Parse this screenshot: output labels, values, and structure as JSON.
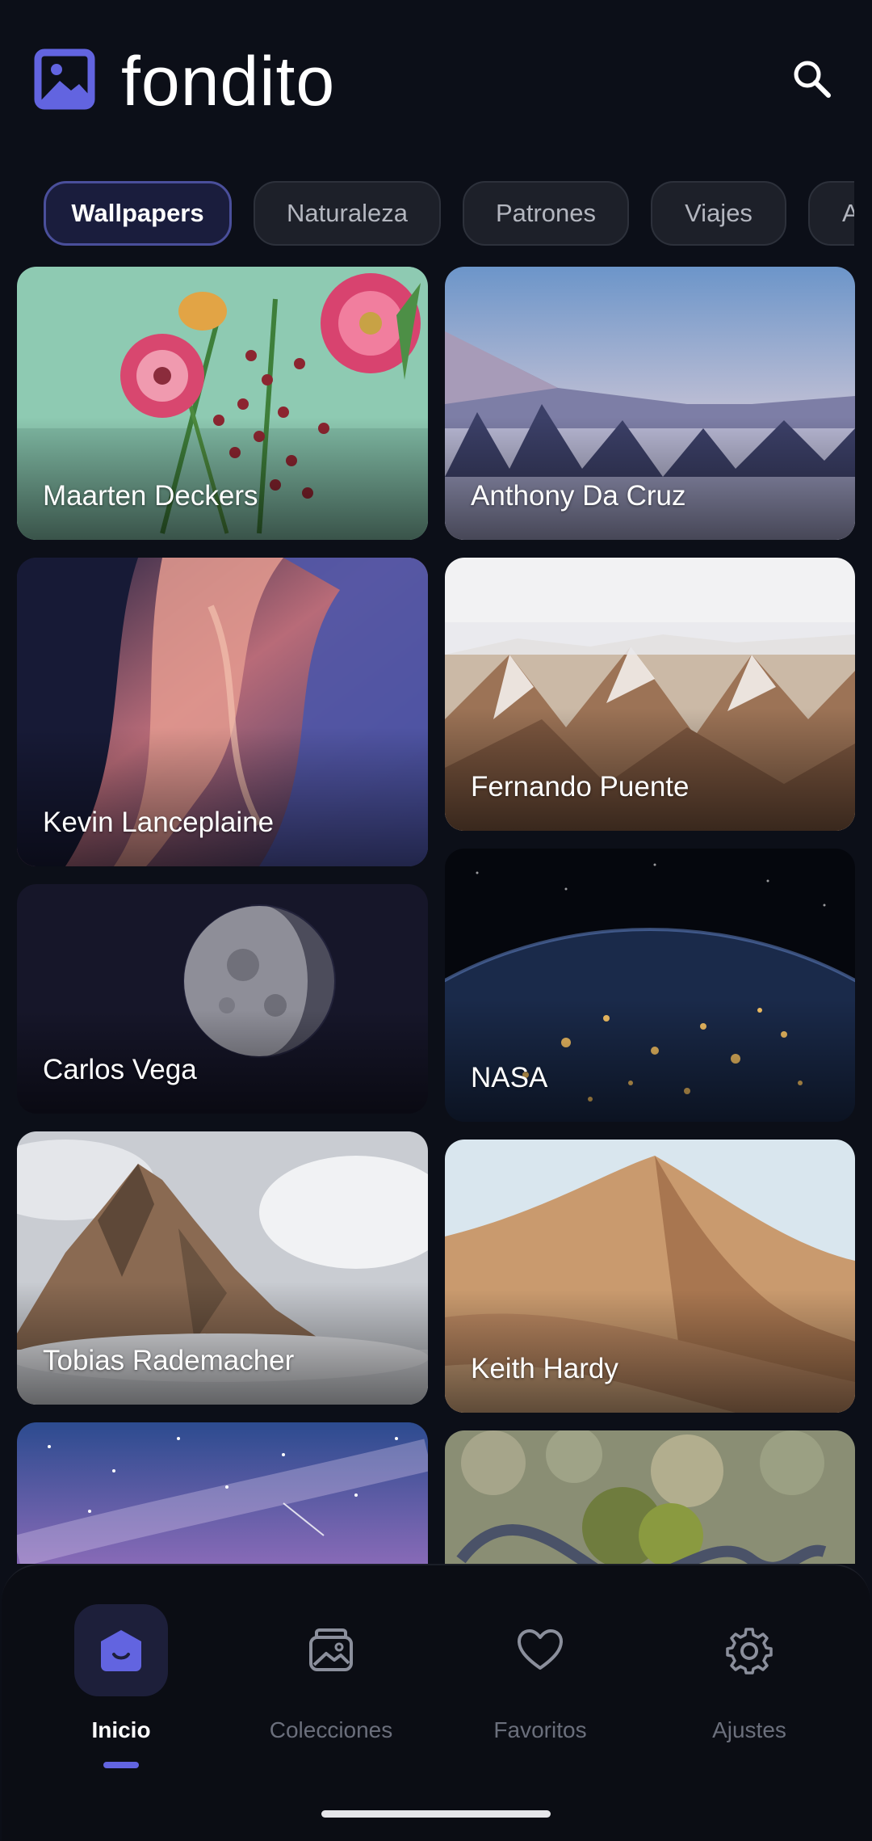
{
  "app": {
    "title": "fondito"
  },
  "colors": {
    "accent": "#6264e0",
    "background": "#0c0f18",
    "chip_active_border": "#4a4f9b"
  },
  "icons": {
    "logo": "image-icon",
    "search": "search-icon"
  },
  "categories": [
    {
      "label": "Wallpapers",
      "selected": true
    },
    {
      "label": "Naturaleza",
      "selected": false
    },
    {
      "label": "Patrones",
      "selected": false
    },
    {
      "label": "Viajes",
      "selected": false
    },
    {
      "label": "A",
      "selected": false
    }
  ],
  "photos": [
    {
      "author": "Maarten Deckers",
      "subject": "flowers"
    },
    {
      "author": "Anthony Da Cruz",
      "subject": "snowy-forest"
    },
    {
      "author": "Kevin Lanceplaine",
      "subject": "canyon"
    },
    {
      "author": "Fernando Puente",
      "subject": "snowy-mountains"
    },
    {
      "author": "Carlos Vega",
      "subject": "moon"
    },
    {
      "author": "NASA",
      "subject": "earth-at-night"
    },
    {
      "author": "Tobias Rademacher",
      "subject": "rocky-peak"
    },
    {
      "author": "Keith Hardy",
      "subject": "sand-dunes"
    },
    {
      "author": "",
      "subject": "milky-way"
    },
    {
      "author": "",
      "subject": "forest-road-aerial"
    }
  ],
  "nav": {
    "items": [
      {
        "label": "Inicio",
        "icon": "home-icon",
        "active": true
      },
      {
        "label": "Colecciones",
        "icon": "collections-icon",
        "active": false
      },
      {
        "label": "Favoritos",
        "icon": "heart-icon",
        "active": false
      },
      {
        "label": "Ajustes",
        "icon": "gear-icon",
        "active": false
      }
    ]
  }
}
